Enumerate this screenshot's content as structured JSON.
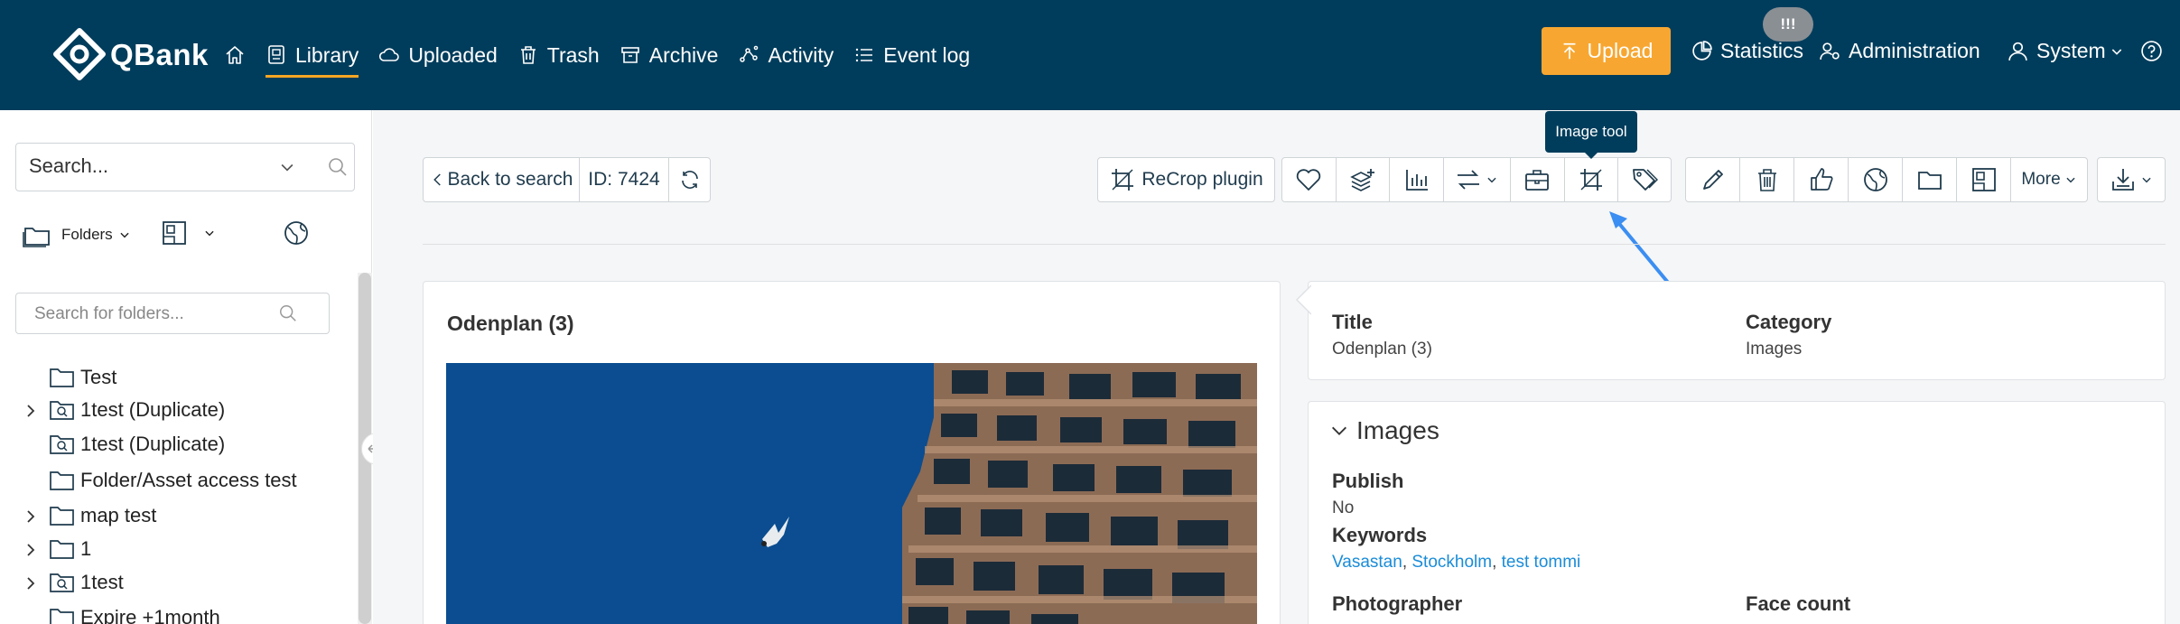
{
  "brand": {
    "name": "QBank"
  },
  "nav": {
    "items": [
      {
        "label": "Library",
        "icon": "library-icon"
      },
      {
        "label": "Uploaded",
        "icon": "cloud-icon"
      },
      {
        "label": "Trash",
        "icon": "trash-icon"
      },
      {
        "label": "Archive",
        "icon": "archive-icon"
      },
      {
        "label": "Activity",
        "icon": "activity-icon"
      },
      {
        "label": "Event log",
        "icon": "list-icon"
      }
    ],
    "upload_label": "Upload",
    "badge": "!!!",
    "statistics_label": "Statistics",
    "administration_label": "Administration",
    "user_label": "System"
  },
  "sidebar": {
    "search_placeholder": "Search...",
    "folders_label": "Folders",
    "folder_search_placeholder": "Search for folders...",
    "tree": [
      {
        "label": "Test",
        "icon": "folder-icon",
        "expandable": false
      },
      {
        "label": "1test (Duplicate)",
        "icon": "smart-folder-icon",
        "expandable": true
      },
      {
        "label": "1test (Duplicate)",
        "icon": "smart-folder-icon",
        "expandable": false
      },
      {
        "label": "Folder/Asset access test",
        "icon": "folder-icon",
        "expandable": false
      },
      {
        "label": "map test",
        "icon": "folder-icon",
        "expandable": true
      },
      {
        "label": "1",
        "icon": "folder-icon",
        "expandable": true
      },
      {
        "label": "1test",
        "icon": "smart-folder-icon",
        "expandable": true
      },
      {
        "label": "Expire +1month",
        "icon": "folder-icon",
        "expandable": false
      }
    ]
  },
  "toolbar": {
    "back_label": "Back to search",
    "id_label": "ID: 7424",
    "recrop_label": "ReCrop plugin",
    "more_label": "More",
    "tooltip": "Image tool"
  },
  "asset": {
    "title": "Odenplan (3)",
    "fields": {
      "title_label": "Title",
      "title_value": "Odenplan (3)",
      "category_label": "Category",
      "category_value": "Images",
      "section_label": "Images",
      "publish_label": "Publish",
      "publish_value": "No",
      "keywords_label": "Keywords",
      "keywords": [
        "Vasastan",
        "Stockholm",
        "test tommi"
      ],
      "photographer_label": "Photographer",
      "face_count_label": "Face count"
    }
  },
  "colors": {
    "topbar": "#003d5c",
    "accent": "#f7a731",
    "link": "#1a8cd8",
    "sky": "#0b4f95"
  }
}
